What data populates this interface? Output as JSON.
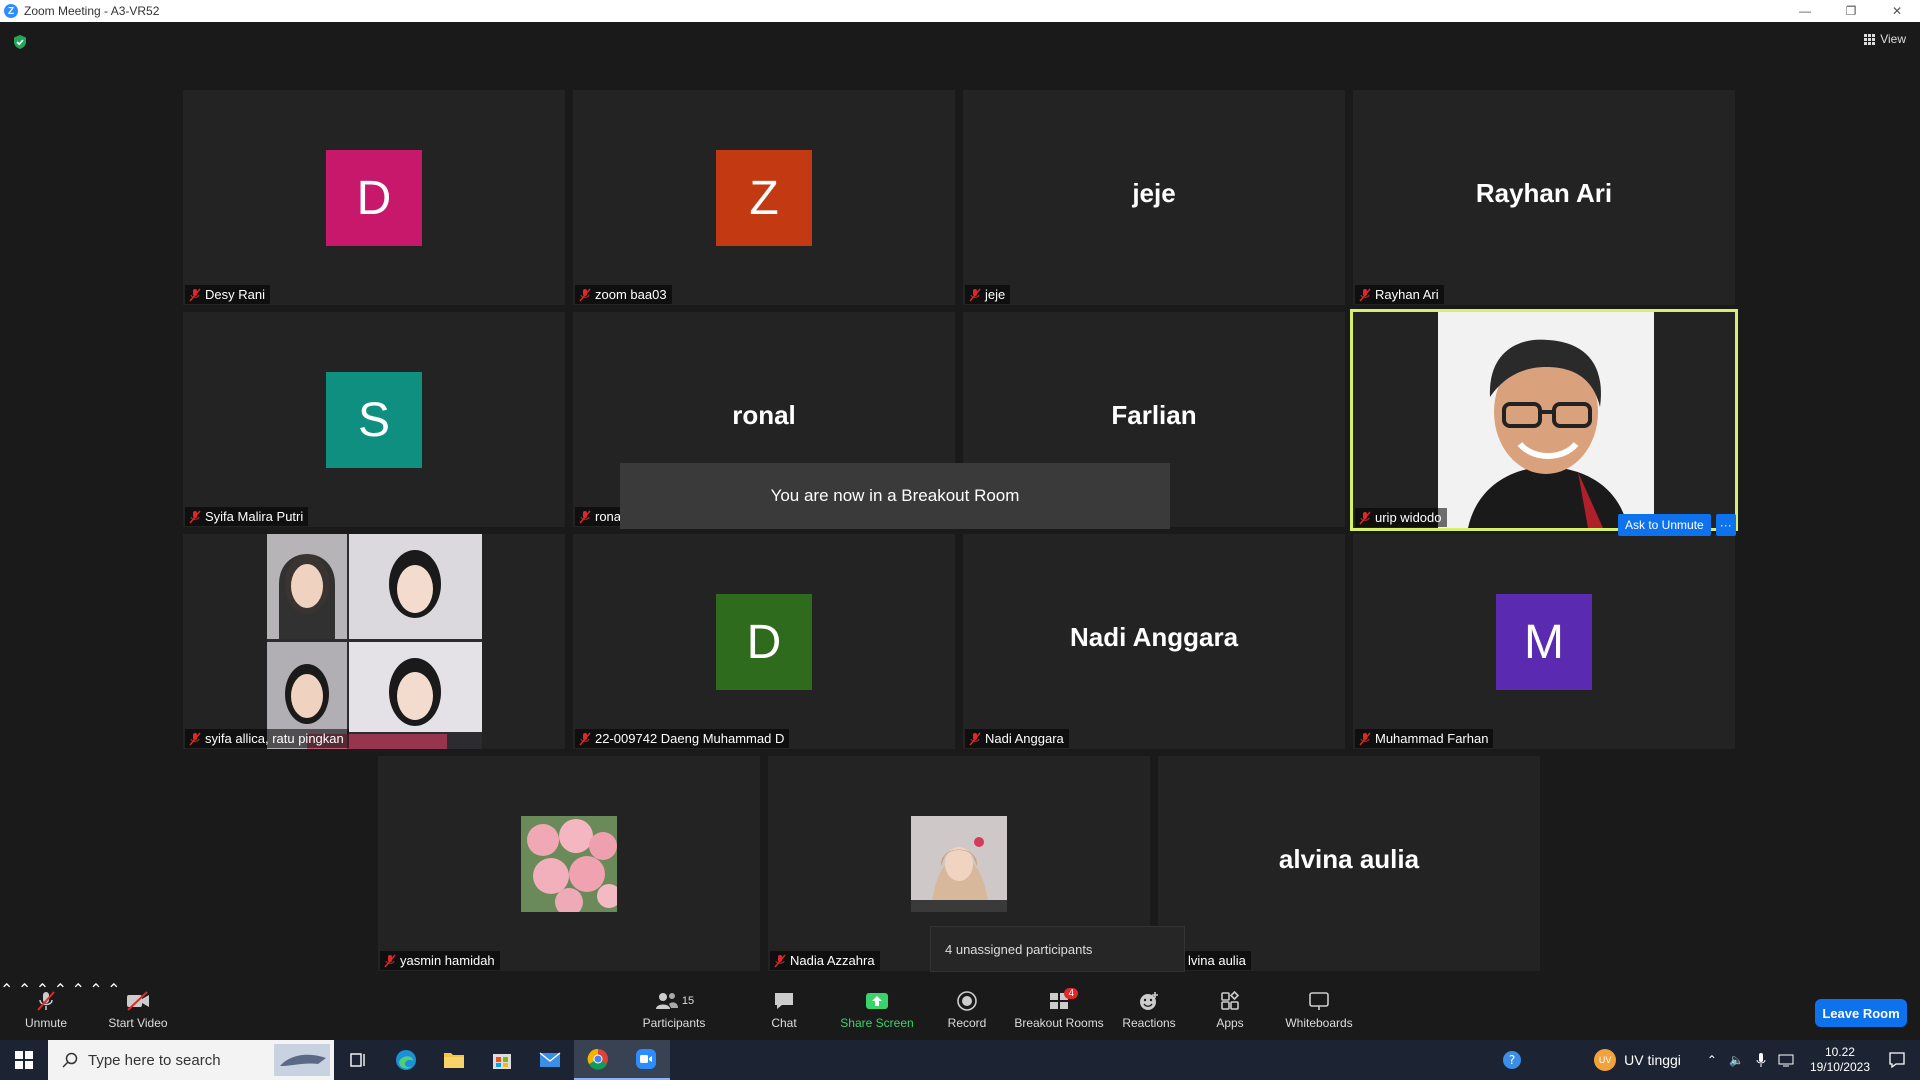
{
  "window": {
    "title": "Zoom Meeting - A3-VR52",
    "minimize": "—",
    "restore": "❐",
    "close": "✕"
  },
  "header": {
    "view_label": "View"
  },
  "tiles": [
    {
      "name": "Desy Rani",
      "initial": "D",
      "color": "#c7186b"
    },
    {
      "name": "zoom baa03",
      "initial": "Z",
      "color": "#c33a12"
    },
    {
      "name": "jeje",
      "display": "jeje"
    },
    {
      "name": "Rayhan Ari",
      "display": "Rayhan Ari"
    },
    {
      "name": "Syifa Malira Putri",
      "initial": "S",
      "color": "#0f8f80"
    },
    {
      "name": "rona",
      "display": "ronal"
    },
    {
      "name": "",
      "display": "Farlian"
    },
    {
      "name": "urip widodo"
    },
    {
      "name": "syifa allica, ratu pingkan"
    },
    {
      "name": "22-009742 Daeng Muhammad D",
      "initial": "D",
      "color": "#2e6b1c"
    },
    {
      "name": "Nadi Anggara",
      "display": "Nadi Anggara"
    },
    {
      "name": "Muhammad Farhan",
      "initial": "M",
      "color": "#5a2bb0"
    },
    {
      "name": "yasmin hamidah"
    },
    {
      "name": "Nadia Azzahra"
    },
    {
      "name": "lvina aulia",
      "display": "alvina aulia"
    }
  ],
  "notice": {
    "breakout": "You are now in a Breakout Room",
    "ask_unmute": "Ask to Unmute",
    "more": "···",
    "unassigned": "4 unassigned participants"
  },
  "toolbar": {
    "unmute": "Unmute",
    "start_video": "Start Video",
    "participants": "Participants",
    "participants_count": "15",
    "chat": "Chat",
    "share_screen": "Share Screen",
    "record": "Record",
    "breakout_rooms": "Breakout Rooms",
    "breakout_badge": "4",
    "reactions": "Reactions",
    "apps": "Apps",
    "whiteboards": "Whiteboards",
    "leave_room": "Leave Room"
  },
  "taskbar": {
    "search_placeholder": "Type here to search",
    "weather": "UV tinggi",
    "weather_badge": "UV",
    "time": "10.22",
    "date": "19/10/2023"
  },
  "colors": {
    "accent": "#0e72ed",
    "active_speaker": "#d7f06a",
    "share_green": "#3ad46a"
  }
}
